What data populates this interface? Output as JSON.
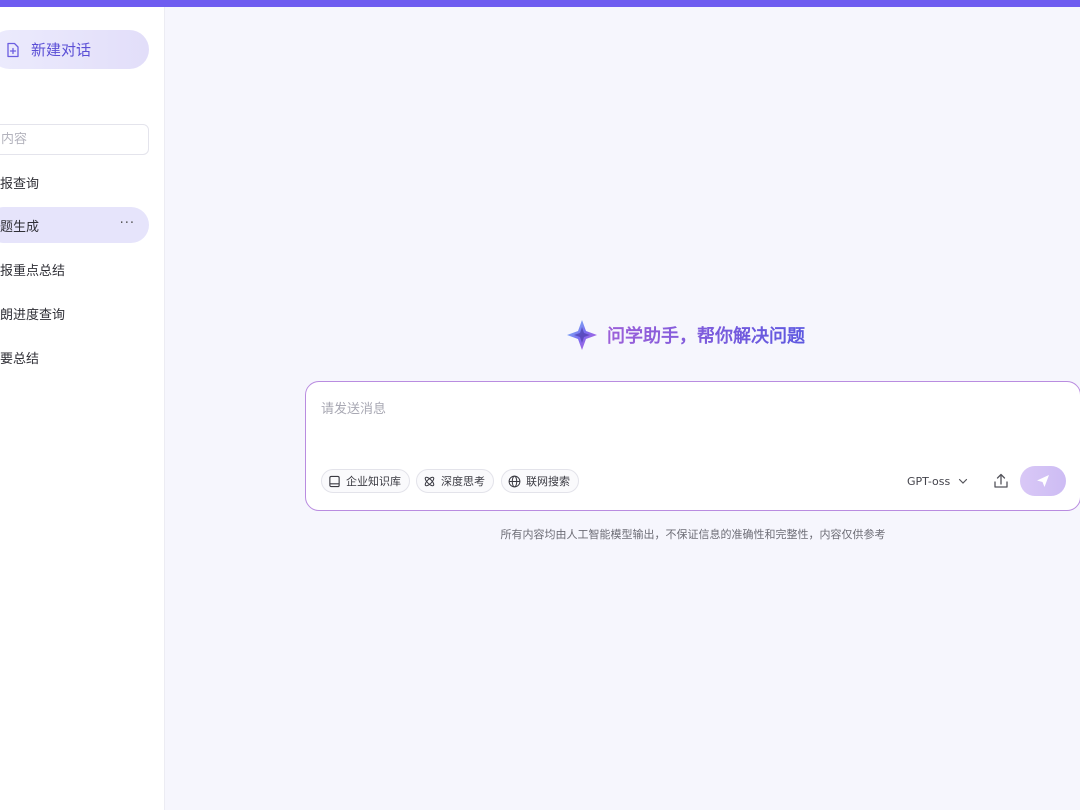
{
  "sidebar": {
    "new_chat_label": "新建对话",
    "search_placeholder": "内容",
    "history": [
      {
        "label": "报查询",
        "active": false
      },
      {
        "label": "题生成",
        "active": true,
        "more": "···"
      },
      {
        "label": "报重点总结",
        "active": false
      },
      {
        "label": "朗进度查询",
        "active": false
      },
      {
        "label": "要总结",
        "active": false
      }
    ]
  },
  "main": {
    "welcome_title": "问学助手，帮你解决问题",
    "composer": {
      "placeholder": "请发送消息",
      "chips": [
        "企业知识库",
        "深度思考",
        "联网搜索"
      ],
      "model": "GPT-oss"
    },
    "disclaimer": "所有内容均由人工智能模型输出，不保证信息的准确性和完整性，内容仅供参考"
  },
  "colors": {
    "accent": "#6e5cf0",
    "active_item_bg": "#e6e4fb",
    "send_button": "#d3c2f5"
  },
  "icons": [
    "new-chat-icon",
    "star-logo-icon",
    "book-icon",
    "atom-icon",
    "globe-icon",
    "chevron-down-icon",
    "upload-icon",
    "send-icon"
  ]
}
